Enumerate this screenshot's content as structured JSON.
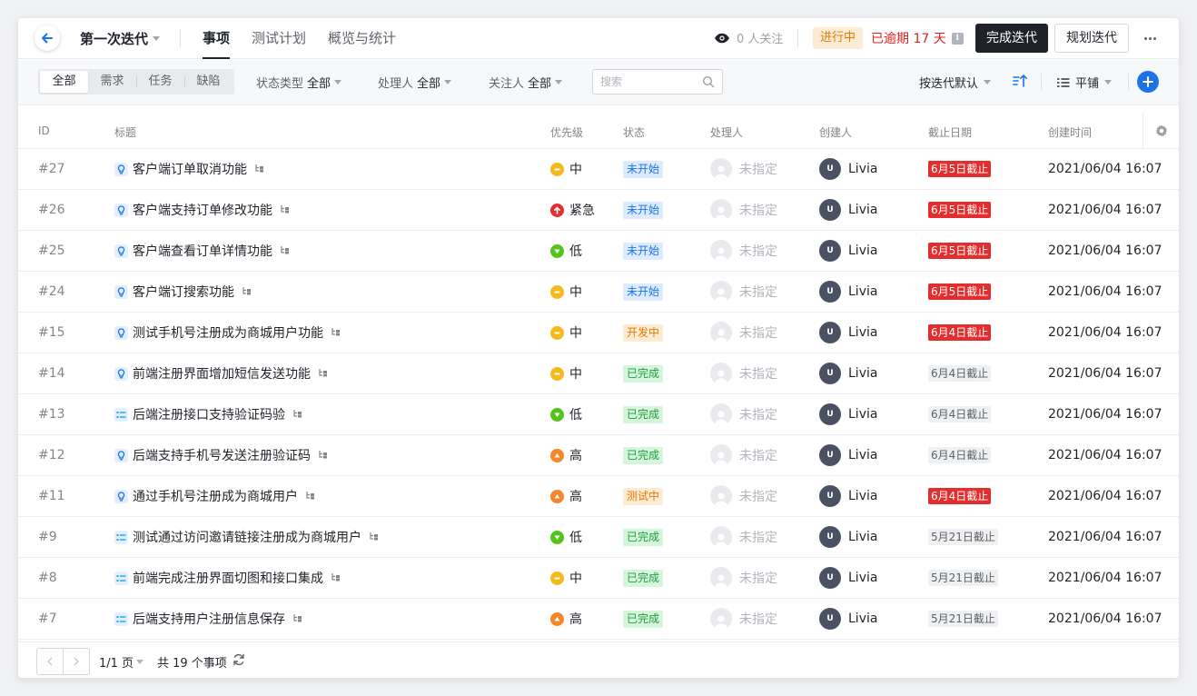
{
  "header": {
    "iteration_title": "第一次迭代",
    "tabs": [
      {
        "label": "事项",
        "active": true
      },
      {
        "label": "测试计划",
        "active": false
      },
      {
        "label": "概览与统计",
        "active": false
      }
    ],
    "watch_label": "0 人关注",
    "status": "进行中",
    "overdue": "已逾期 17 天",
    "complete_btn": "完成迭代",
    "plan_btn": "规划迭代"
  },
  "toolbar": {
    "segments": [
      {
        "label": "全部",
        "active": true
      },
      {
        "label": "需求",
        "active": false
      },
      {
        "label": "任务",
        "active": false
      },
      {
        "label": "缺陷",
        "active": false
      }
    ],
    "filters": [
      {
        "key": "状态类型",
        "value": "全部"
      },
      {
        "key": "处理人",
        "value": "全部"
      },
      {
        "key": "关注人",
        "value": "全部"
      }
    ],
    "search_placeholder": "搜索",
    "sort_label": "按迭代默认",
    "view_label": "平铺"
  },
  "table": {
    "columns": [
      "ID",
      "标题",
      "优先级",
      "状态",
      "处理人",
      "创建人",
      "截止日期",
      "创建时间"
    ],
    "rows": [
      {
        "id": "#27",
        "type": "requirement",
        "title": "客户端订单取消功能",
        "priority": "中",
        "status": "未开始",
        "assignee": "未指定",
        "creator": "Livia",
        "due": "6月5日截止",
        "due_overdue": true,
        "created": "2021/06/04 16:07"
      },
      {
        "id": "#26",
        "type": "requirement",
        "title": "客户端支持订单修改功能",
        "priority": "紧急",
        "status": "未开始",
        "assignee": "未指定",
        "creator": "Livia",
        "due": "6月5日截止",
        "due_overdue": true,
        "created": "2021/06/04 16:07"
      },
      {
        "id": "#25",
        "type": "requirement",
        "title": "客户端查看订单详情功能",
        "priority": "低",
        "status": "未开始",
        "assignee": "未指定",
        "creator": "Livia",
        "due": "6月5日截止",
        "due_overdue": true,
        "created": "2021/06/04 16:07"
      },
      {
        "id": "#24",
        "type": "requirement",
        "title": "客户端订搜索功能",
        "priority": "中",
        "status": "未开始",
        "assignee": "未指定",
        "creator": "Livia",
        "due": "6月5日截止",
        "due_overdue": true,
        "created": "2021/06/04 16:07"
      },
      {
        "id": "#15",
        "type": "requirement",
        "title": "测试手机号注册成为商城用户功能",
        "priority": "中",
        "status": "开发中",
        "assignee": "未指定",
        "creator": "Livia",
        "due": "6月4日截止",
        "due_overdue": true,
        "created": "2021/06/04 16:07"
      },
      {
        "id": "#14",
        "type": "requirement",
        "title": "前端注册界面增加短信发送功能",
        "priority": "中",
        "status": "已完成",
        "assignee": "未指定",
        "creator": "Livia",
        "due": "6月4日截止",
        "due_overdue": false,
        "created": "2021/06/04 16:07"
      },
      {
        "id": "#13",
        "type": "task",
        "title": "后端注册接口支持验证码验",
        "priority": "低",
        "status": "已完成",
        "assignee": "未指定",
        "creator": "Livia",
        "due": "6月4日截止",
        "due_overdue": false,
        "created": "2021/06/04 16:07"
      },
      {
        "id": "#12",
        "type": "requirement",
        "title": "后端支持手机号发送注册验证码",
        "priority": "高",
        "status": "已完成",
        "assignee": "未指定",
        "creator": "Livia",
        "due": "6月4日截止",
        "due_overdue": false,
        "created": "2021/06/04 16:07"
      },
      {
        "id": "#11",
        "type": "requirement",
        "title": "通过手机号注册成为商城用户",
        "priority": "高",
        "status": "测试中",
        "assignee": "未指定",
        "creator": "Livia",
        "due": "6月4日截止",
        "due_overdue": true,
        "created": "2021/06/04 16:07"
      },
      {
        "id": "#9",
        "type": "task",
        "title": "测试通过访问邀请链接注册成为商城用户",
        "priority": "低",
        "status": "已完成",
        "assignee": "未指定",
        "creator": "Livia",
        "due": "5月21日截止",
        "due_overdue": false,
        "created": "2021/06/04 16:07"
      },
      {
        "id": "#8",
        "type": "task",
        "title": "前端完成注册界面切图和接口集成",
        "priority": "中",
        "status": "已完成",
        "assignee": "未指定",
        "creator": "Livia",
        "due": "5月21日截止",
        "due_overdue": false,
        "created": "2021/06/04 16:07"
      },
      {
        "id": "#7",
        "type": "task",
        "title": "后端支持用户注册信息保存",
        "priority": "高",
        "status": "已完成",
        "assignee": "未指定",
        "creator": "Livia",
        "due": "5月21日截止",
        "due_overdue": false,
        "created": "2021/06/04 16:07"
      }
    ]
  },
  "footer": {
    "page_info": "1/1 页",
    "total": "共 19 个事项"
  },
  "colors": {
    "priority": {
      "中": "#f5b91e",
      "紧急": "#e22e2e",
      "低": "#52c41a",
      "高": "#f5862a"
    },
    "status": {
      "未开始": {
        "bg": "#dcebff",
        "fg": "#1a73e8"
      },
      "开发中": {
        "bg": "#fdebd3",
        "fg": "#e07b00"
      },
      "已完成": {
        "bg": "#d5f5dc",
        "fg": "#1e9e3e"
      },
      "测试中": {
        "bg": "#fdebd3",
        "fg": "#e07b00"
      }
    },
    "accent": "#1a73e8",
    "danger": "#e22e2e"
  }
}
